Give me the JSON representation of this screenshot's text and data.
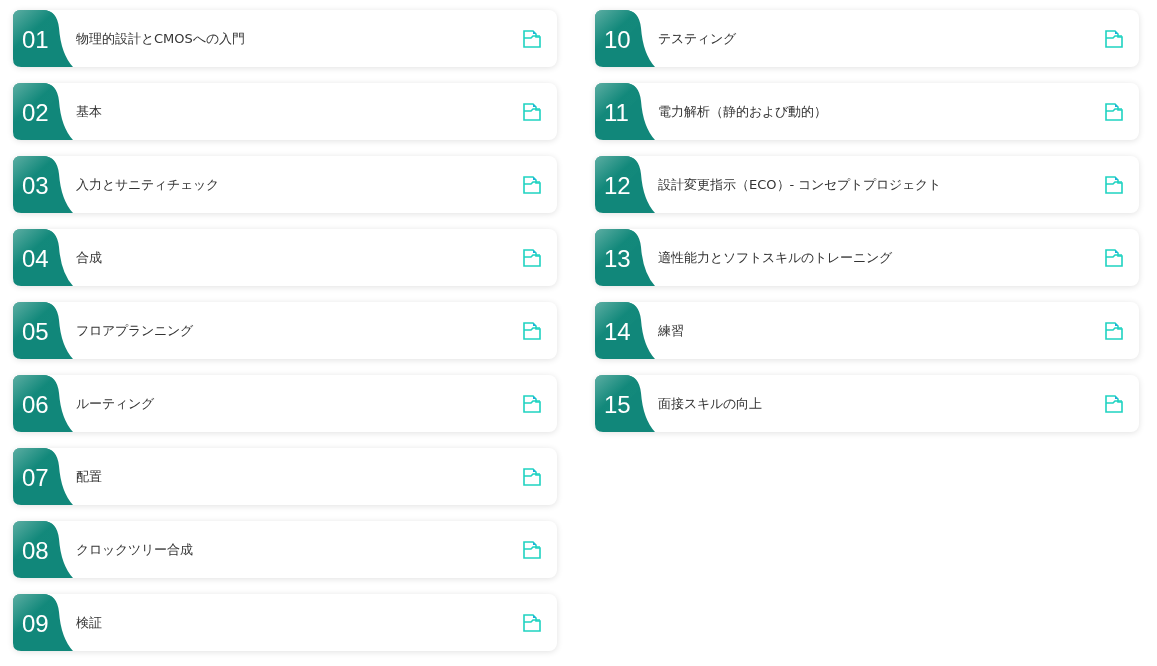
{
  "columns": [
    {
      "modules": [
        {
          "number": "01",
          "title": "物理的設計とCMOSへの入門"
        },
        {
          "number": "02",
          "title": "基本"
        },
        {
          "number": "03",
          "title": "入力とサニティチェック"
        },
        {
          "number": "04",
          "title": "合成"
        },
        {
          "number": "05",
          "title": "フロアプランニング"
        },
        {
          "number": "06",
          "title": "ルーティング"
        },
        {
          "number": "07",
          "title": "配置"
        },
        {
          "number": "08",
          "title": "クロックツリー合成"
        },
        {
          "number": "09",
          "title": "検証"
        }
      ]
    },
    {
      "modules": [
        {
          "number": "10",
          "title": "テスティング"
        },
        {
          "number": "11",
          "title": "電力解析（静的および動的）"
        },
        {
          "number": "12",
          "title": "設計変更指示（ECO）- コンセプトプロジェクト"
        },
        {
          "number": "13",
          "title": "適性能力とソフトスキルのトレーニング"
        },
        {
          "number": "14",
          "title": "練習"
        },
        {
          "number": "15",
          "title": "面接スキルの向上"
        }
      ]
    }
  ]
}
